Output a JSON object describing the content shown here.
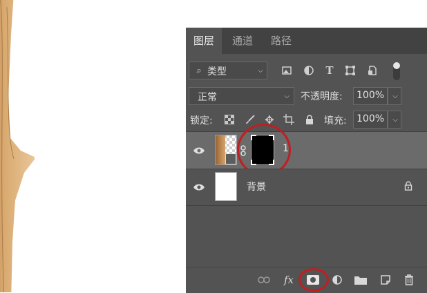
{
  "panel": {
    "tabs": [
      {
        "label": "图层",
        "active": true
      },
      {
        "label": "通道",
        "active": false
      },
      {
        "label": "路径",
        "active": false
      }
    ],
    "filter": {
      "kind_label": "类型",
      "icons": [
        "image-filter-icon",
        "adjustment-filter-icon",
        "type-filter-icon",
        "shape-filter-icon",
        "smart-object-filter-icon",
        "filter-toggle"
      ]
    },
    "blend": {
      "mode": "正常",
      "opacity_label": "不透明度:",
      "opacity_value": "100%"
    },
    "lock": {
      "label": "锁定:",
      "fill_label": "填充:",
      "fill_value": "100%"
    },
    "layers": [
      {
        "name": "1",
        "selected": true,
        "visible": true,
        "has_mask": true
      },
      {
        "name": "背景",
        "selected": false,
        "visible": true,
        "locked": true
      }
    ],
    "bottom_icons": [
      "link-icon",
      "fx-icon",
      "add-mask-icon",
      "adjustment-layer-icon",
      "new-group-icon",
      "new-layer-icon",
      "trash-icon"
    ],
    "colors": {
      "panel_bg": "#535353",
      "selected_row": "#6b6b6b",
      "tab_bar": "#424242",
      "highlight_circle": "#c21d22"
    }
  }
}
